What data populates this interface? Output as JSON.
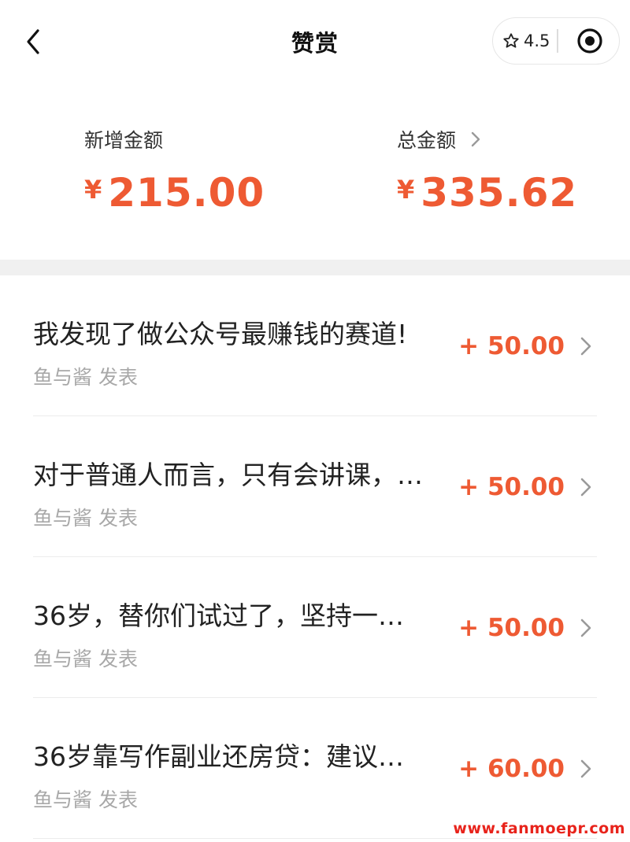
{
  "nav": {
    "title": "赞赏",
    "rating": "4.5"
  },
  "summary": {
    "new_label": "新增金额",
    "new_currency": "¥",
    "new_amount": "215.00",
    "total_label": "总金额",
    "total_currency": "¥",
    "total_amount": "335.62"
  },
  "list": [
    {
      "title": "我发现了做公众号最赚钱的赛道!",
      "author": "鱼与酱 发表",
      "amount": "+ 50.00"
    },
    {
      "title": "对于普通人而言，只有会讲课，…",
      "author": "鱼与酱 发表",
      "amount": "+ 50.00"
    },
    {
      "title": "36岁，替你们试过了，坚持一…",
      "author": "鱼与酱 发表",
      "amount": "+ 50.00"
    },
    {
      "title": "36岁靠写作副业还房贷：建议…",
      "author": "鱼与酱 发表",
      "amount": "+ 60.00"
    }
  ],
  "watermark": "www.fanmoepr.com",
  "colors": {
    "accent": "#ee5a33",
    "muted_text": "#a8a8a8",
    "separator": "#f0f0f0"
  },
  "icons": {
    "back": "chevron-left-icon",
    "rating": "star-outline-icon",
    "capsule": "target-circle-icon",
    "row": "chevron-right-icon"
  }
}
